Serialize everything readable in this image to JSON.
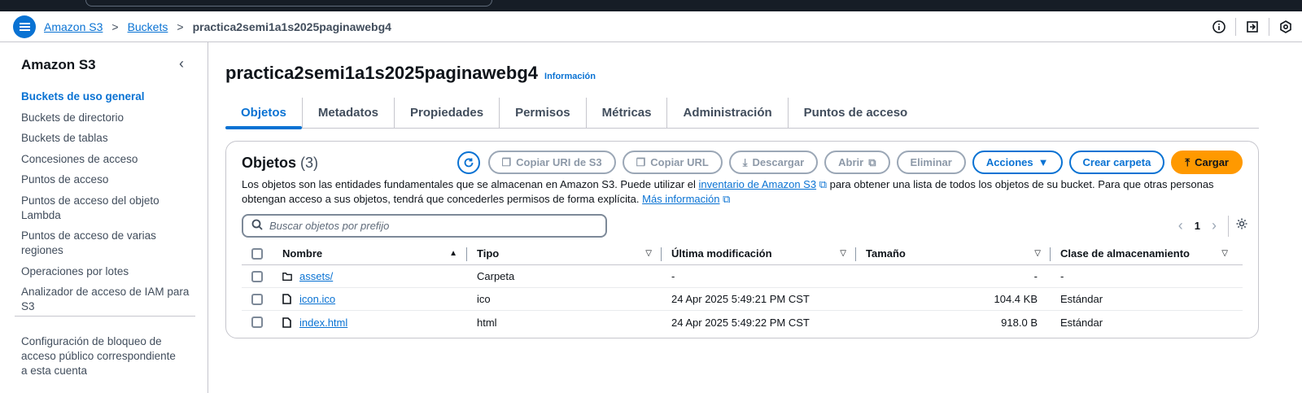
{
  "breadcrumb": {
    "items": [
      "Amazon S3",
      "Buckets"
    ],
    "current": "practica2semi1a1s2025paginawebg4",
    "separator": ">"
  },
  "sidebar": {
    "title": "Amazon S3",
    "items": [
      {
        "label": "Buckets de uso general",
        "active": true
      },
      {
        "label": "Buckets de directorio"
      },
      {
        "label": "Buckets de tablas"
      },
      {
        "label": "Concesiones de acceso"
      },
      {
        "label": "Puntos de acceso"
      },
      {
        "label": "Puntos de acceso del objeto Lambda"
      },
      {
        "label": "Puntos de acceso de varias regiones"
      },
      {
        "label": "Operaciones por lotes"
      },
      {
        "label": "Analizador de acceso de IAM para S3"
      }
    ],
    "footer": "Configuración de bloqueo de acceso público correspondiente a esta cuenta"
  },
  "page": {
    "title": "practica2semi1a1s2025paginawebg4",
    "info": "Información"
  },
  "tabs": [
    "Objetos",
    "Metadatos",
    "Propiedades",
    "Permisos",
    "Métricas",
    "Administración",
    "Puntos de acceso"
  ],
  "objects": {
    "title": "Objetos",
    "count": "(3)",
    "buttons": {
      "copy_uri": "Copiar URI de S3",
      "copy_url": "Copiar URL",
      "download": "Descargar",
      "open": "Abrir",
      "delete": "Eliminar",
      "actions": "Acciones",
      "create_folder": "Crear carpeta",
      "upload": "Cargar"
    },
    "description_1": "Los objetos son las entidades fundamentales que se almacenan en Amazon S3. Puede utilizar el",
    "description_link_1": "inventario de Amazon S3",
    "description_2": "para obtener una lista de todos los objetos de su bucket. Para que otras personas obtengan acceso a sus objetos, tendrá que concederles permisos de forma explícita.",
    "description_link_2": "Más información",
    "search_placeholder": "Buscar objetos por prefijo",
    "page_number": "1",
    "columns": [
      "Nombre",
      "Tipo",
      "Última modificación",
      "Tamaño",
      "Clase de almacenamiento"
    ],
    "rows": [
      {
        "name": "assets/",
        "type": "Carpeta",
        "modified": "-",
        "size": "-",
        "class": "-",
        "icon": "folder-icon"
      },
      {
        "name": "icon.ico",
        "type": "ico",
        "modified": "24 Apr 2025 5:49:21 PM CST",
        "size": "104.4 KB",
        "class": "Estándar",
        "icon": "file-icon"
      },
      {
        "name": "index.html",
        "type": "html",
        "modified": "24 Apr 2025 5:49:22 PM CST",
        "size": "918.0 B",
        "class": "Estándar",
        "icon": "file-icon"
      }
    ]
  },
  "colors": {
    "accent": "#0972d3",
    "upload": "#ff9900",
    "topbar": "#161d26"
  }
}
